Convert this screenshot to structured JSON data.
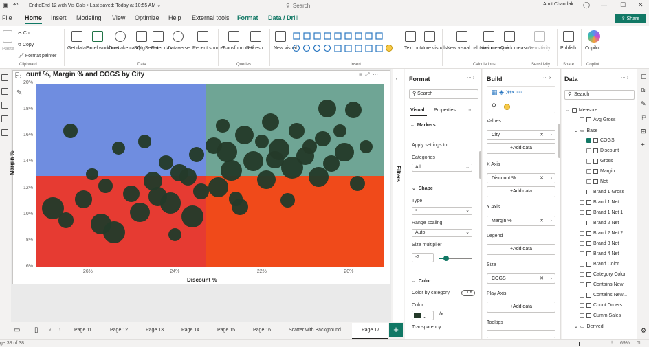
{
  "titlebar": {
    "title": "EndtoEnd 12 with Vis Cals  •  Last saved: Today at 10:55 AM ⌄",
    "search_placeholder": "Search",
    "user": "Amit Chandak"
  },
  "menu": [
    "File",
    "Home",
    "Insert",
    "Modeling",
    "View",
    "Optimize",
    "Help",
    "External tools",
    "Format",
    "Data / Drill"
  ],
  "share_label": "Share",
  "ribbon": {
    "clipboard": {
      "paste": "Paste",
      "cut": "Cut",
      "copy": "Copy",
      "format_painter": "Format painter",
      "group": "Clipboard"
    },
    "data": {
      "items": [
        "Get data",
        "Excel workbook",
        "OneLake catalog",
        "SQL Server",
        "Enter data",
        "Dataverse",
        "Recent sources"
      ],
      "group": "Data"
    },
    "queries": {
      "items": [
        "Transform data",
        "Refresh"
      ],
      "group": "Queries"
    },
    "insert": {
      "new_visual": "New visual",
      "text_box": "Text box",
      "more_visuals": "More visuals",
      "group": "Insert"
    },
    "calculations": {
      "items": [
        "New visual calculation",
        "New measure",
        "Quick measure"
      ],
      "group": "Calculations"
    },
    "sensitivity": {
      "label": "Sensitivity",
      "group": "Sensitivity"
    },
    "share": {
      "label": "Publish",
      "group": "Share"
    },
    "copilot": {
      "label": "Copilot",
      "group": "Copilot"
    }
  },
  "visual": {
    "title": "ount %, Margin % and COGS by City",
    "xlabel": "Discount %",
    "ylabel": "Margin %"
  },
  "chart_data": {
    "type": "scatter",
    "title": "ount %, Margin % and COGS by City",
    "xlabel": "Discount %",
    "ylabel": "Margin %",
    "x_ticks": [
      "26%",
      "24%",
      "22%",
      "20%"
    ],
    "y_ticks": [
      "20%",
      "18%",
      "16%",
      "14%",
      "12%",
      "10%",
      "8%",
      "6%"
    ],
    "xlim": [
      27.2,
      19.2
    ],
    "ylim": [
      6,
      20
    ],
    "x_reverse": true,
    "quadrant_split": {
      "x": 23.3,
      "y": 13
    },
    "quadrant_colors": {
      "top_left": "#6f8de0",
      "top_right": "#6fa595",
      "bottom_left": "#e63b32",
      "bottom_right": "#f04a1a"
    },
    "point_color": "#243a2a",
    "points": [
      [
        26.8,
        10.5,
        2.0
      ],
      [
        26.5,
        9.6,
        1.4
      ],
      [
        26.1,
        11.2,
        1.6
      ],
      [
        25.7,
        9.3,
        1.9
      ],
      [
        25.4,
        8.7,
        2.0
      ],
      [
        25.0,
        11.6,
        1.5
      ],
      [
        24.8,
        10.2,
        1.8
      ],
      [
        24.5,
        12.6,
        1.7
      ],
      [
        24.1,
        10.9,
        1.9
      ],
      [
        23.9,
        13.2,
        1.6
      ],
      [
        23.6,
        9.9,
        2.0
      ],
      [
        23.4,
        11.8,
        1.4
      ],
      [
        23.0,
        12.1,
        1.8
      ],
      [
        22.7,
        13.4,
        1.9
      ],
      [
        22.5,
        10.6,
        1.5
      ],
      [
        22.2,
        14.1,
        1.8
      ],
      [
        21.9,
        12.7,
        1.7
      ],
      [
        21.6,
        15.0,
        1.9
      ],
      [
        21.3,
        13.6,
        2.0
      ],
      [
        21.0,
        14.5,
        1.6
      ],
      [
        20.7,
        12.9,
        1.8
      ],
      [
        20.4,
        13.9,
        1.5
      ],
      [
        20.1,
        14.8,
        1.7
      ],
      [
        19.8,
        12.4,
        1.4
      ],
      [
        24.2,
        14.0,
        1.3
      ],
      [
        23.1,
        15.3,
        1.5
      ],
      [
        22.4,
        16.1,
        1.7
      ],
      [
        21.8,
        17.1,
        1.6
      ],
      [
        21.2,
        16.4,
        1.4
      ],
      [
        20.5,
        18.1,
        1.6
      ],
      [
        19.9,
        18.0,
        1.5
      ],
      [
        22.9,
        16.8,
        1.2
      ],
      [
        25.9,
        13.1,
        1.1
      ],
      [
        24.7,
        15.6,
        1.2
      ],
      [
        23.5,
        14.6,
        1.4
      ],
      [
        22.0,
        15.6,
        1.3
      ],
      [
        20.9,
        15.2,
        1.3
      ],
      [
        20.2,
        16.4,
        1.2
      ],
      [
        26.4,
        16.4,
        1.3
      ],
      [
        25.3,
        15.1,
        1.2
      ],
      [
        22.6,
        11.2,
        1.3
      ],
      [
        21.4,
        11.1,
        1.3
      ],
      [
        24.0,
        8.5,
        1.2
      ],
      [
        23.7,
        12.9,
        1.6
      ],
      [
        22.8,
        14.8,
        1.9
      ],
      [
        21.7,
        14.2,
        1.6
      ],
      [
        20.6,
        15.8,
        1.4
      ],
      [
        19.6,
        15.2,
        1.2
      ],
      [
        25.6,
        12.2,
        1.3
      ],
      [
        24.4,
        11.4,
        1.7
      ]
    ]
  },
  "filters_label": "Filters",
  "format_pane": {
    "title": "Format",
    "search_placeholder": "Search",
    "tabs": [
      "Visual",
      "Properties"
    ],
    "markers": "Markers",
    "apply_settings": "Apply settings to",
    "categories_label": "Categories",
    "categories_value": "All",
    "shape": "Shape",
    "type_label": "Type",
    "type_value": "•",
    "range_scaling_label": "Range scaling",
    "range_scaling_value": "Auto",
    "size_multiplier_label": "Size multiplier",
    "size_multiplier_value": "-2",
    "color": "Color",
    "color_by_category": "Color by category",
    "toggle_off": "Off",
    "color_label": "Color",
    "fx": "fx",
    "transparency": "Transparency"
  },
  "build_pane": {
    "title": "Build",
    "values_label": "Values",
    "values_field": "City",
    "x_label": "X Axis",
    "x_field": "Discount %",
    "y_label": "Y Axis",
    "y_field": "Margin %",
    "legend_label": "Legend",
    "size_label": "Size",
    "size_field": "COGS",
    "play_label": "Play Axis",
    "tooltips_label": "Tooltips",
    "add_data": "+Add data"
  },
  "data_pane": {
    "title": "Data",
    "search_placeholder": "Search",
    "measure": "Measure",
    "avg_gross": "Avg Gross",
    "base": "Base",
    "base_items": [
      "COGS",
      "Discount",
      "Gross",
      "Margin",
      "Net"
    ],
    "items": [
      "Brand 1 Gross",
      "Brand 1 Net",
      "Brand 1 Net 1",
      "Brand 2 Net",
      "Brand 2 Net 2",
      "Brand 3 Net",
      "Brand 4 Net",
      "Brand Color",
      "Category Color",
      "Contains New",
      "Contains New...",
      "Count Orders",
      "Cumm Sales"
    ],
    "derived": "Derived"
  },
  "tabs": [
    "Page 11",
    "Page 12",
    "Page 13",
    "Page 14",
    "Page 15",
    "Page 16",
    "Scatter with Background",
    "Page 17"
  ],
  "status": {
    "page": "ge 38 of 38",
    "zoom": "69%"
  }
}
